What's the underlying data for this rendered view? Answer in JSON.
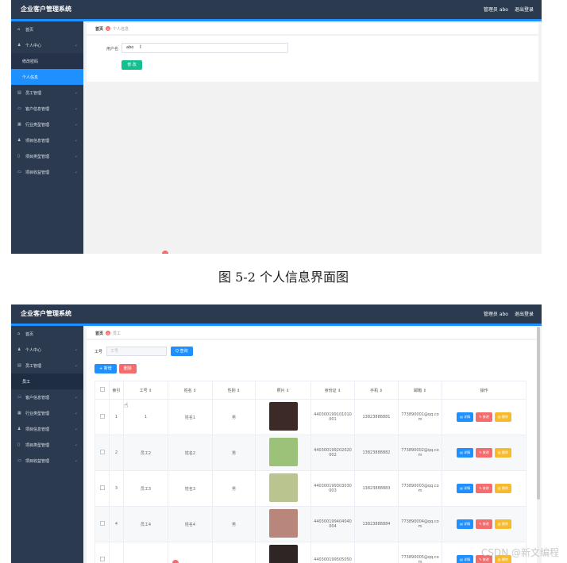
{
  "shot1": {
    "app_title": "企业客户管理系统",
    "user": "管理员 abo",
    "logout": "退出登录",
    "menu": [
      {
        "icon": "home-icon",
        "glyph": "⌂",
        "label": "首页"
      },
      {
        "icon": "user-icon",
        "glyph": "♟",
        "label": "个人中心",
        "chevron": true
      },
      {
        "label": "修改密码",
        "sub": true
      },
      {
        "label": "个人信息",
        "sub": true,
        "active": true
      },
      {
        "icon": "team-icon",
        "glyph": "▤",
        "label": "员工管理",
        "chevron": true
      },
      {
        "icon": "monitor-icon",
        "glyph": "▭",
        "label": "客户信息管理",
        "chevron": true
      },
      {
        "icon": "grid-icon",
        "glyph": "▦",
        "label": "行业类型管理",
        "chevron": true
      },
      {
        "icon": "user-icon",
        "glyph": "♟",
        "label": "项目信息管理",
        "chevron": true
      },
      {
        "icon": "phone-icon",
        "glyph": "▯",
        "label": "项目类型管理",
        "chevron": true
      },
      {
        "icon": "monitor-icon",
        "glyph": "▭",
        "label": "项目收益管理",
        "chevron": true
      }
    ],
    "breadcrumb": {
      "home": "首页",
      "current": "个人信息"
    },
    "form": {
      "username_label": "用户名",
      "username_value": "abo",
      "save_label": "修 改"
    }
  },
  "caption": "图 5-2 个人信息界面图",
  "shot2": {
    "app_title": "企业客户管理系统",
    "user": "管理员 abo",
    "logout": "退出登录",
    "menu": [
      {
        "icon": "home-icon",
        "glyph": "⌂",
        "label": "首页"
      },
      {
        "icon": "user-icon",
        "glyph": "♟",
        "label": "个人中心",
        "chevron": true
      },
      {
        "icon": "team-icon",
        "glyph": "▤",
        "label": "员工管理",
        "chevron": true
      },
      {
        "label": "员工",
        "sub": true,
        "active_dark": true
      },
      {
        "icon": "monitor-icon",
        "glyph": "▭",
        "label": "客户信息管理",
        "chevron": true
      },
      {
        "icon": "grid-icon",
        "glyph": "▦",
        "label": "行业类型管理",
        "chevron": true
      },
      {
        "icon": "user-icon",
        "glyph": "♟",
        "label": "项目信息管理",
        "chevron": true
      },
      {
        "icon": "phone-icon",
        "glyph": "▯",
        "label": "项目类型管理",
        "chevron": true
      },
      {
        "icon": "monitor-icon",
        "glyph": "▭",
        "label": "项目收益管理",
        "chevron": true
      }
    ],
    "breadcrumb": {
      "home": "首页",
      "current": "员工"
    },
    "search": {
      "label": "工号",
      "placeholder": "工号",
      "button": "Q 查询"
    },
    "actions": {
      "add": "+ 新增",
      "delete": "删除"
    },
    "columns": [
      "索引",
      "工号 ⇕",
      "姓名 ⇕",
      "性别 ⇕",
      "照片 ⇕",
      "身份证 ⇕",
      "手机 ⇕",
      "邮箱 ⇕",
      "操作"
    ],
    "rows": [
      {
        "index": "1",
        "emp_no": "1",
        "name": "姓名1",
        "gender": "男",
        "photo_color": "#3b2a25",
        "id_card": "440300199101010001",
        "phone": "13823888881",
        "email": "773890001@qq.com"
      },
      {
        "index": "2",
        "emp_no": "员工2",
        "name": "姓名2",
        "gender": "男",
        "photo_color": "#9cc27a",
        "id_card": "440300199202020002",
        "phone": "13823888882",
        "email": "773890002@qq.com"
      },
      {
        "index": "3",
        "emp_no": "员工3",
        "name": "姓名3",
        "gender": "男",
        "photo_color": "#b9c48f",
        "id_card": "440300199303030003",
        "phone": "13823888883",
        "email": "773890003@qq.com"
      },
      {
        "index": "4",
        "emp_no": "员工4",
        "name": "姓名4",
        "gender": "男",
        "photo_color": "#b8867a",
        "id_card": "440300199404040004",
        "phone": "13823888884",
        "email": "773890004@qq.com"
      },
      {
        "index": "",
        "emp_no": "",
        "name": "",
        "gender": "",
        "photo_color": "#2e2624",
        "id_card": "440300199505050",
        "phone": "",
        "email": "773890005@qq.com"
      }
    ],
    "row_ops": {
      "detail": "▤ 详情",
      "edit": "✎ 修改",
      "delete": "▥ 删除"
    }
  },
  "watermark": "CSDN @新文编程"
}
